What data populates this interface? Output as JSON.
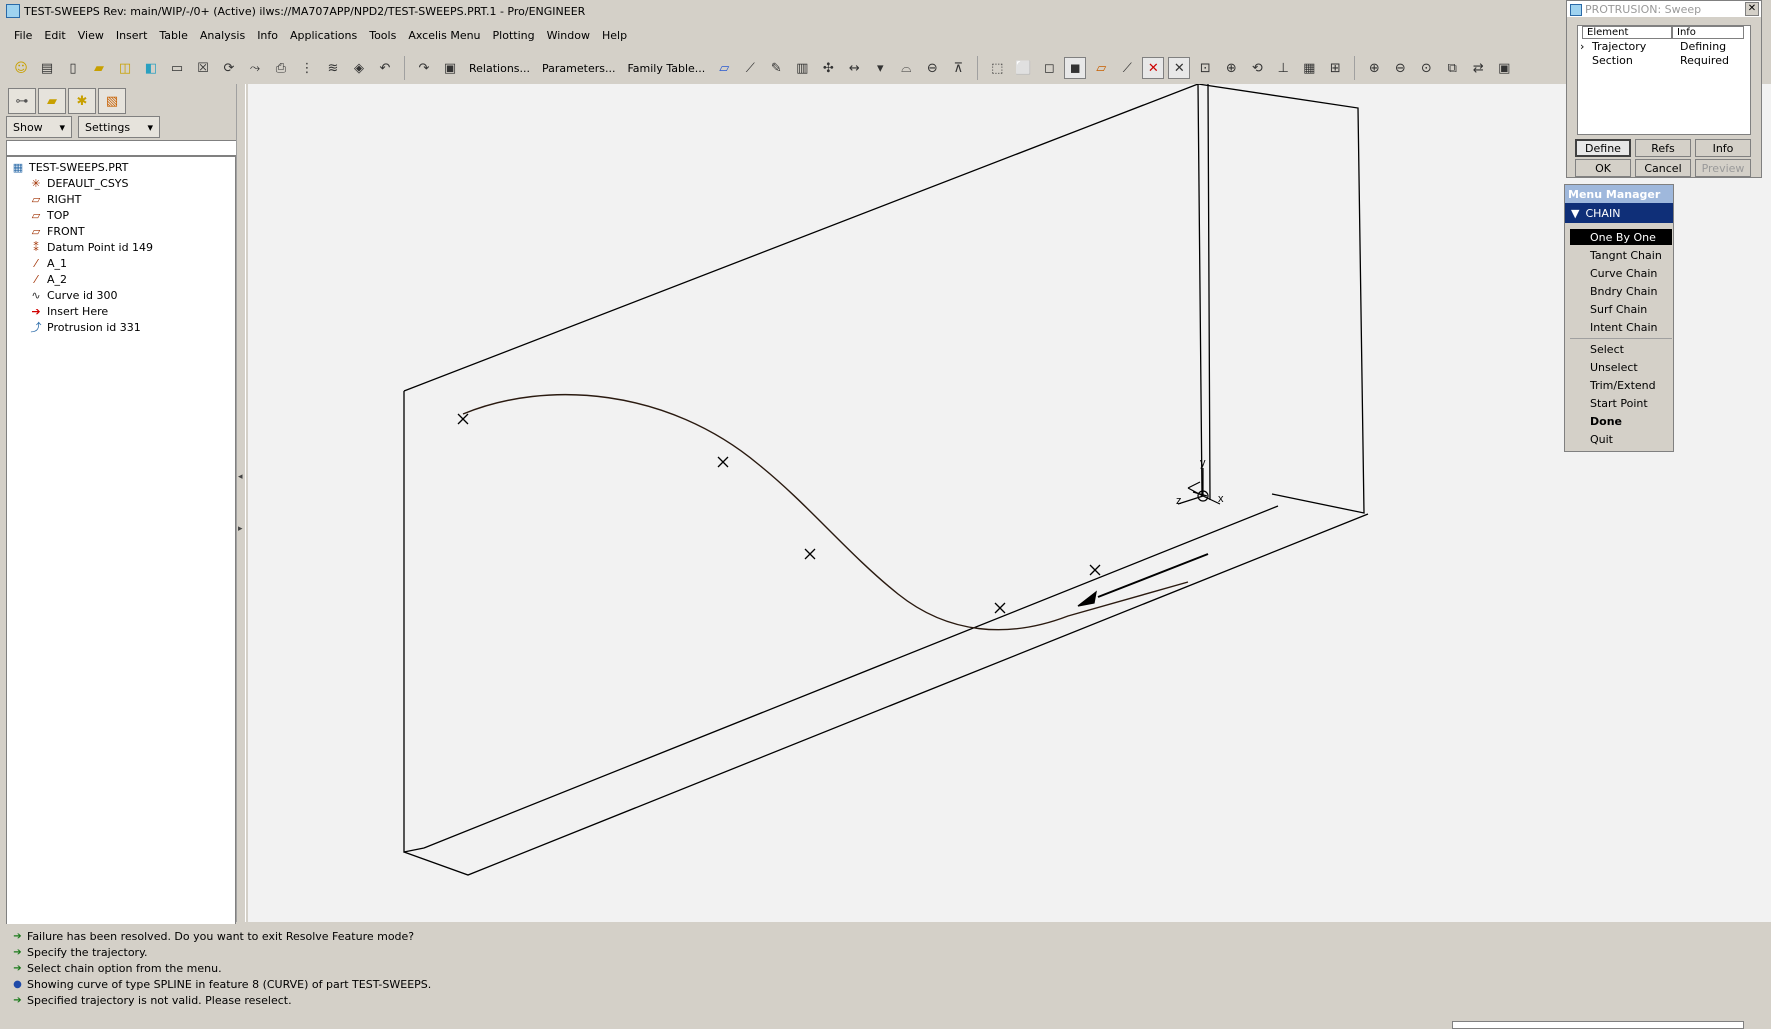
{
  "window": {
    "title": "TEST-SWEEPS Rev: main/WIP/-/0+ (Active) ilws://MA707APP/NPD2/TEST-SWEEPS.PRT.1 - Pro/ENGINEER"
  },
  "menubar": [
    "File",
    "Edit",
    "View",
    "Insert",
    "Table",
    "Analysis",
    "Info",
    "Applications",
    "Tools",
    "Axcelis Menu",
    "Plotting",
    "Window",
    "Help"
  ],
  "toolbar": {
    "relations": "Relations...",
    "parameters": "Parameters...",
    "family_table": "Family Table..."
  },
  "left_panel": {
    "show_label": "Show",
    "settings_label": "Settings",
    "tree": [
      {
        "label": "TEST-SWEEPS.PRT",
        "icon": "part-icon"
      },
      {
        "label": "DEFAULT_CSYS",
        "icon": "csys-icon"
      },
      {
        "label": "RIGHT",
        "icon": "datum-plane-icon"
      },
      {
        "label": "TOP",
        "icon": "datum-plane-icon"
      },
      {
        "label": "FRONT",
        "icon": "datum-plane-icon"
      },
      {
        "label": "Datum Point id 149",
        "icon": "datum-point-icon"
      },
      {
        "label": "A_1",
        "icon": "datum-axis-icon"
      },
      {
        "label": "A_2",
        "icon": "datum-axis-icon"
      },
      {
        "label": "Curve id 300",
        "icon": "curve-icon"
      },
      {
        "label": "Insert Here",
        "icon": "insert-here-arrow-icon"
      },
      {
        "label": "Protrusion id 331",
        "icon": "protrusion-icon"
      }
    ]
  },
  "dialog": {
    "title": "PROTRUSION: Sweep",
    "columns": [
      "Element",
      "Info"
    ],
    "rows": [
      {
        "element": "Trajectory",
        "info": "Defining"
      },
      {
        "element": "Section",
        "info": "Required"
      }
    ],
    "buttons": {
      "define": "Define",
      "refs": "Refs",
      "info": "Info",
      "ok": "OK",
      "cancel": "Cancel",
      "preview": "Preview"
    }
  },
  "menu_manager": {
    "title": "Menu Manager",
    "header": "CHAIN",
    "group1": [
      "One By One",
      "Tangnt Chain",
      "Curve Chain",
      "Bndry Chain",
      "Surf Chain",
      "Intent Chain"
    ],
    "group2": [
      "Select",
      "Unselect",
      "Trim/Extend",
      "Start Point",
      "Done",
      "Quit"
    ]
  },
  "messages": [
    {
      "text": "Failure has been resolved. Do you want to exit Resolve Feature mode?",
      "icon": "arrow-icon"
    },
    {
      "text": "Specify the trajectory.",
      "icon": "arrow-icon"
    },
    {
      "text": "Select chain option from the menu.",
      "icon": "arrow-icon"
    },
    {
      "text": "Showing curve of type SPLINE in feature 8 (CURVE) of part TEST-SWEEPS.",
      "icon": "dot-icon"
    },
    {
      "text": "Specified trajectory is not valid. Please reselect.",
      "icon": "arrow-icon"
    }
  ],
  "viewport": {
    "axis_labels": [
      "y",
      "z",
      "x"
    ]
  }
}
